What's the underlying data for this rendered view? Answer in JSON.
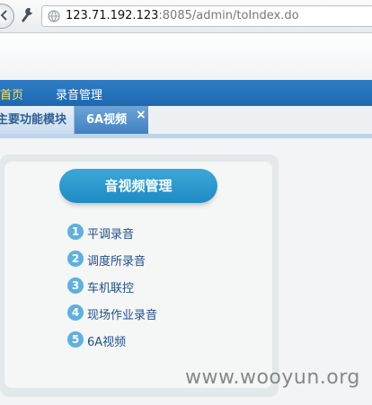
{
  "browser": {
    "url_host": "123.71.192.123",
    "url_rest": ":8085/admin/toIndex.do"
  },
  "nav": {
    "items": [
      {
        "label": "首页",
        "active": true
      },
      {
        "label": "录音管理",
        "active": false
      }
    ]
  },
  "tabs": [
    {
      "label": "主要功能模块",
      "active": false
    },
    {
      "label": "6A视频",
      "active": true,
      "closable": true,
      "close_glyph": "×"
    }
  ],
  "panel": {
    "title": "音视频管理",
    "items": [
      {
        "num": "1",
        "label": "平调录音"
      },
      {
        "num": "2",
        "label": "调度所录音"
      },
      {
        "num": "3",
        "label": "车机联控"
      },
      {
        "num": "4",
        "label": "现场作业录音"
      },
      {
        "num": "5",
        "label": "6A视频"
      }
    ]
  },
  "watermark": "www.wooyun.org",
  "colors": {
    "nav_bg": "#2f7dc5",
    "nav_active": "#ffe54d",
    "title_pill": "#2a98d0",
    "number_badge": "#5fb0df",
    "menu_link": "#1f4f8a"
  }
}
